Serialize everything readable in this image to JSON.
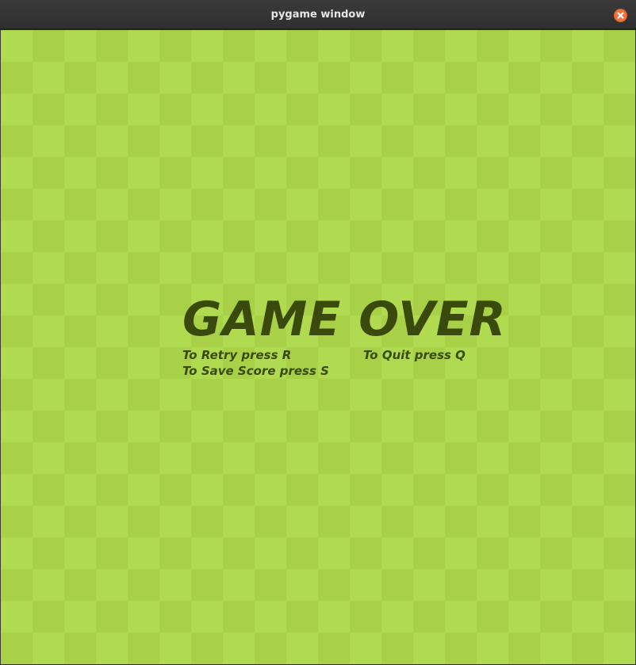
{
  "window": {
    "title": "pygame window",
    "close_icon": "close-icon"
  },
  "game": {
    "board_colors": {
      "light": "#b0db50",
      "dark": "#a8d148"
    },
    "text_color": "#3a4a0d",
    "title": "GAME OVER",
    "retry_hint": "To Retry press R",
    "quit_hint": "To Quit press Q",
    "save_hint": "To Save Score press S"
  }
}
